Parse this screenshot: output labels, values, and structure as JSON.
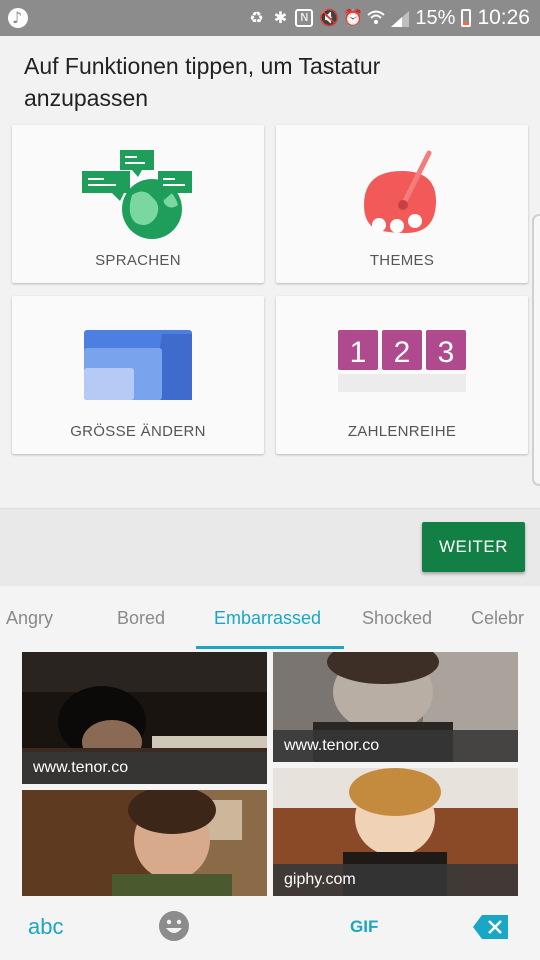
{
  "status_bar": {
    "battery_percent": "15%",
    "time": "10:26",
    "icons": [
      "music-icon",
      "battery-saver-icon",
      "bluetooth-icon",
      "nfc-icon",
      "mute-icon",
      "alarm-icon",
      "wifi-icon",
      "signal-icon",
      "battery-icon"
    ]
  },
  "header": {
    "title": "Auf Funktionen tippen, um Tastatur anzupassen"
  },
  "tiles": [
    {
      "label": "SPRACHEN",
      "icon": "globe-chat-icon"
    },
    {
      "label": "THEMES",
      "icon": "palette-icon"
    },
    {
      "label": "GRÖSSE ÄNDERN",
      "icon": "resize-icon"
    },
    {
      "label": "ZAHLENREIHE",
      "icon": "number-row-icon"
    }
  ],
  "number_row_digits": [
    "1",
    "2",
    "3"
  ],
  "actions": {
    "next_label": "WEITER"
  },
  "gif_keyboard": {
    "categories": [
      "Angry",
      "Bored",
      "Embarrassed",
      "Shocked",
      "Celebr"
    ],
    "active_category": "Embarrassed",
    "gifs": [
      {
        "source": "www.tenor.co"
      },
      {
        "source": "www.tenor.co"
      },
      {
        "source": ""
      },
      {
        "source": "giphy.com"
      }
    ],
    "bottom": {
      "abc_label": "abc",
      "gif_label": "GIF",
      "emoji_icon": "smiley-icon",
      "backspace_icon": "backspace-icon"
    }
  },
  "colors": {
    "accent": "#1aa7c5",
    "button": "#127f45",
    "status_bar": "#8c8c8c"
  }
}
